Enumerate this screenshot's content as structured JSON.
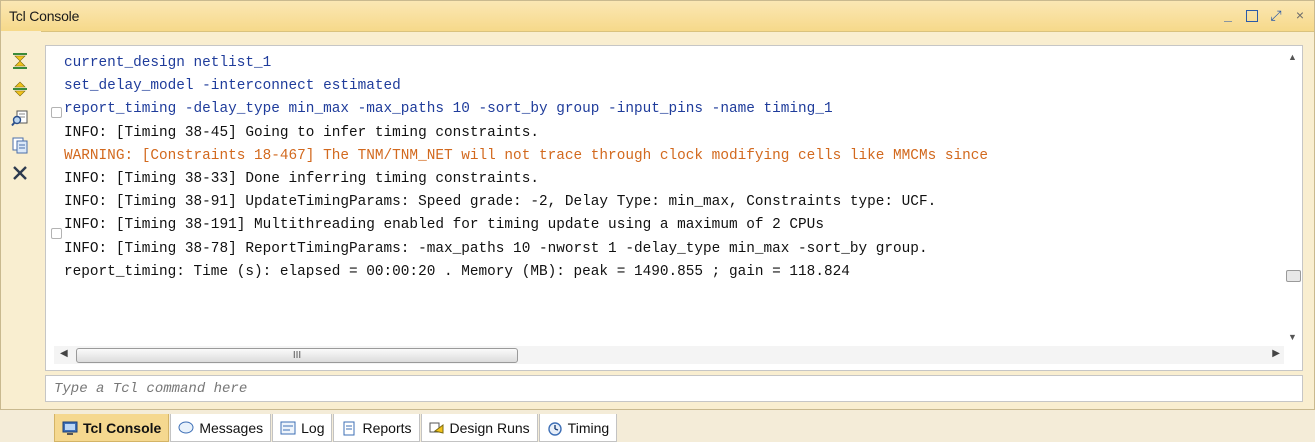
{
  "window": {
    "title": "Tcl Console",
    "controls": {
      "minimize_glyph": "_",
      "maximize_icon": "maximize-icon",
      "float_glyph": "⤢",
      "close_glyph": "×"
    }
  },
  "toolbar": {
    "icons": [
      "collapse-all-icon",
      "expand-all-icon",
      "find-icon",
      "copy-icon",
      "clear-icon"
    ]
  },
  "console": {
    "lines": [
      {
        "text": "current_design netlist_1",
        "kind": "cmd"
      },
      {
        "text": "set_delay_model -interconnect estimated",
        "kind": "cmd"
      },
      {
        "text": "report_timing -delay_type min_max -max_paths 10 -sort_by group -input_pins -name timing_1",
        "kind": "cmd"
      },
      {
        "text": "INFO: [Timing 38-45] Going to infer timing constraints.",
        "kind": "info"
      },
      {
        "text": "WARNING: [Constraints 18-467] The TNM/TNM_NET will not trace through clock modifying cells like MMCMs since",
        "kind": "warn"
      },
      {
        "text": "INFO: [Timing 38-33] Done inferring timing constraints.",
        "kind": "info"
      },
      {
        "text": "INFO: [Timing 38-91] UpdateTimingParams: Speed grade: -2, Delay Type: min_max, Constraints type: UCF.",
        "kind": "info"
      },
      {
        "text": "INFO: [Timing 38-191] Multithreading enabled for timing update using a maximum of 2 CPUs",
        "kind": "info"
      },
      {
        "text": "INFO: [Timing 38-78] ReportTimingParams: -max_paths 10 -nworst 1 -delay_type min_max -sort_by group.",
        "kind": "info"
      },
      {
        "text": "report_timing: Time (s): elapsed = 00:00:20 . Memory (MB): peak = 1490.855 ; gain = 118.824",
        "kind": "info"
      }
    ],
    "hscroll_thumb_label": "III"
  },
  "input": {
    "placeholder": "Type a Tcl command here",
    "value": ""
  },
  "tabs": [
    {
      "label": "Tcl Console",
      "icon": "console-icon",
      "active": true
    },
    {
      "label": "Messages",
      "icon": "messages-icon",
      "active": false
    },
    {
      "label": "Log",
      "icon": "log-icon",
      "active": false
    },
    {
      "label": "Reports",
      "icon": "reports-icon",
      "active": false
    },
    {
      "label": "Design Runs",
      "icon": "design-runs-icon",
      "active": false
    },
    {
      "label": "Timing",
      "icon": "timing-icon",
      "active": false
    }
  ],
  "colors": {
    "command": "#1f3c9b",
    "info": "#111111",
    "warning": "#d2691e",
    "active_tab": "#f5d88f"
  }
}
